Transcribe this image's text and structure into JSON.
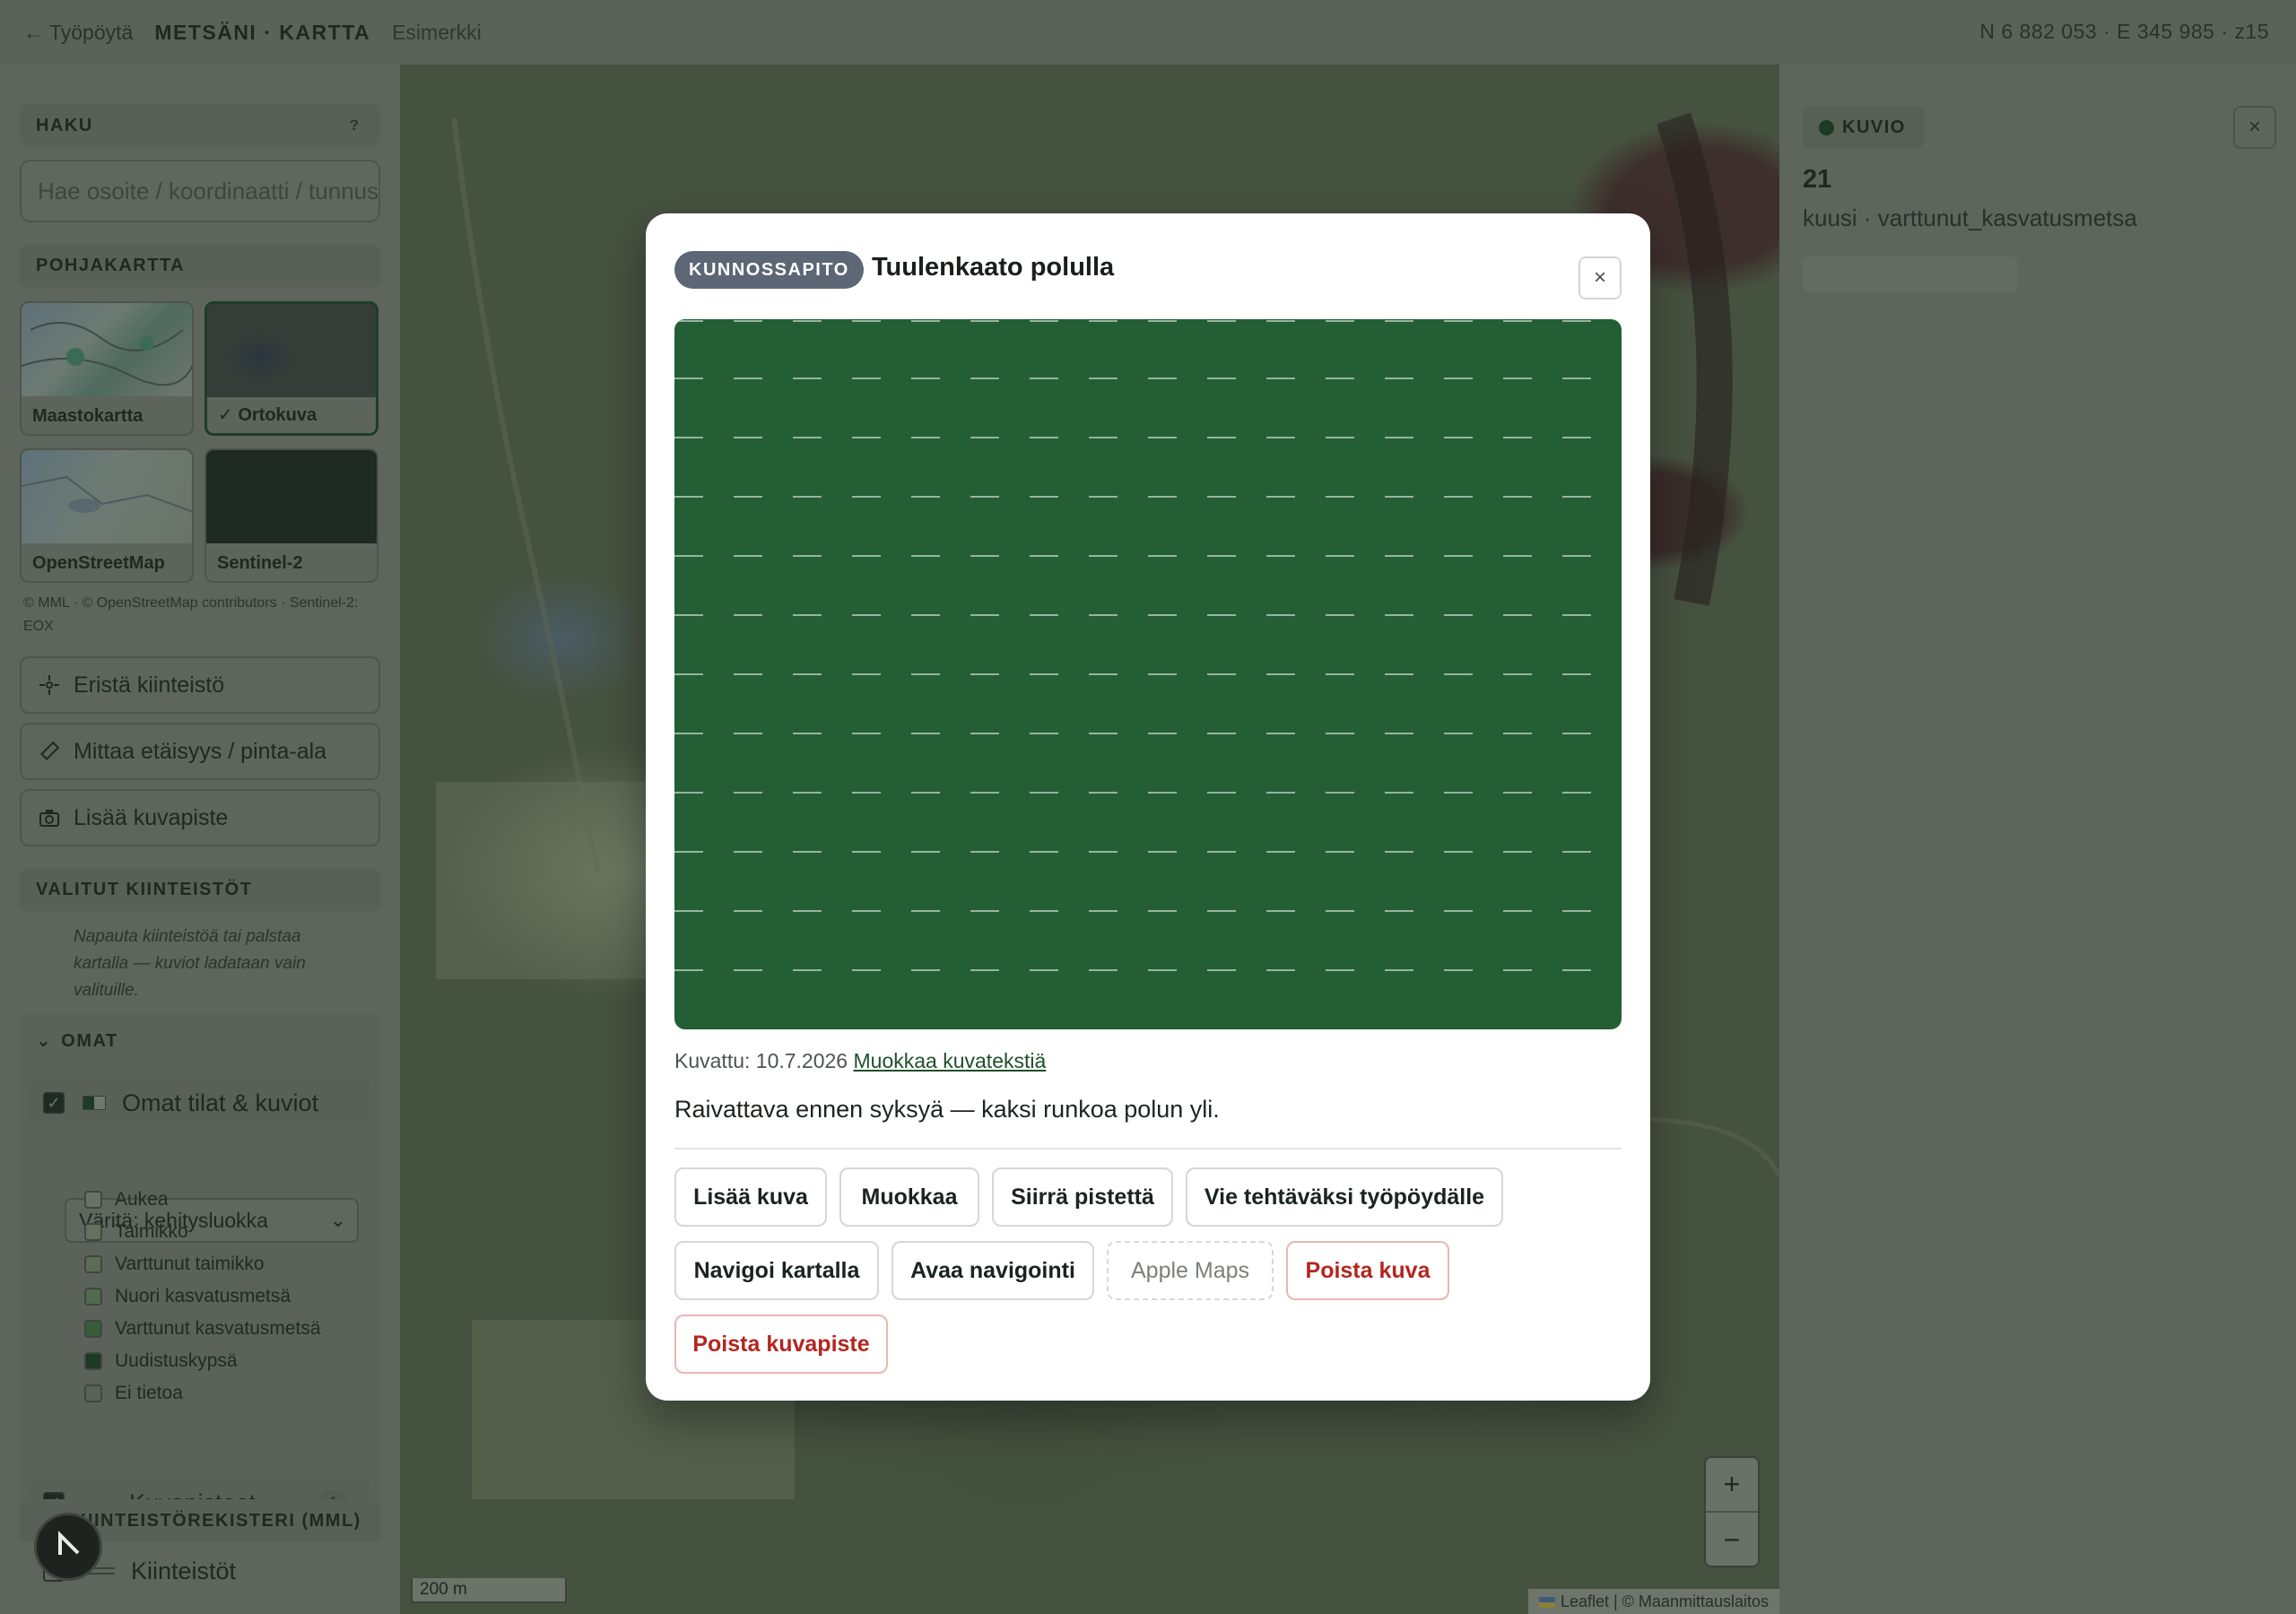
{
  "topbar": {
    "back": "← Työpöytä",
    "brand": "METSÄNI · KARTTA",
    "example": "Esimerkki",
    "coords": "N 6 882 053 · E 345 985 · z15"
  },
  "sidebar": {
    "search_head": "HAKU",
    "search_help": "?",
    "search_placeholder": "Hae osoite / koordinaatti / tunnus",
    "basemap_head": "POHJAKARTTA",
    "basemaps": [
      {
        "label": "Maastokartta",
        "selected": false
      },
      {
        "label": "✓ Ortokuva",
        "selected": true
      },
      {
        "label": "OpenStreetMap",
        "selected": false
      },
      {
        "label": "Sentinel-2",
        "selected": false
      }
    ],
    "credit": "© MML · © OpenStreetMap contributors · Sentinel-2: EOX",
    "tools": [
      {
        "label": "Eristä kiinteistö",
        "icon": "crosshair-icon"
      },
      {
        "label": "Mittaa etäisyys / pinta-ala",
        "icon": "ruler-icon"
      },
      {
        "label": "Lisää kuvapiste",
        "icon": "camera-icon"
      }
    ],
    "selected_head": "VALITUT KIINTEISTÖT",
    "selected_hint": "Napauta kiinteistöä tai palstaa kartalla — kuviot ladataan vain valituille.",
    "omat_head": "OMAT",
    "omat_layer": "Omat tilat & kuviot",
    "color_select": "Väritä: kehitysluokka",
    "legend": [
      {
        "label": "Aukea",
        "color": "#6a7266"
      },
      {
        "label": "Taimikko",
        "color": "#66705f"
      },
      {
        "label": "Varttunut taimikko",
        "color": "#5c6c57"
      },
      {
        "label": "Nuori kasvatusmetsä",
        "color": "#4f6a4c"
      },
      {
        "label": "Varttunut kasvatusmetsä",
        "color": "#385d3b"
      },
      {
        "label": "Uudistuskypsä",
        "color": "#1f3a24"
      },
      {
        "label": "Ei tietoa",
        "color": "#5a6159"
      }
    ],
    "photo_layer": "Kuvapisteet",
    "photo_count": "1",
    "registry_head": "KIINTEISTÖREKISTERI (MML)",
    "registry_layer": "Kiinteistöt"
  },
  "map": {
    "scale": "200 m",
    "attribution": "Leaflet | © Maanmittauslaitos",
    "zoom_in": "+",
    "zoom_out": "−"
  },
  "right_panel": {
    "badge": "KUVIO",
    "close": "×",
    "number": "21",
    "description": "kuusi · varttunut_kasvatusmetsa"
  },
  "modal": {
    "tag": "KUNNOSSAPITO",
    "title": "Tuulenkaato polulla",
    "close": "×",
    "caption_prefix": "Kuvattu: 10.7.2026",
    "caption_link": "Muokkaa kuvatekstiä",
    "note": "Raivattava ennen syksyä — kaksi runkoa polun yli.",
    "buttons": {
      "add_photo": "Lisää kuva",
      "edit": "Muokkaa",
      "move_point": "Siirrä pistettä",
      "export_task": "Vie tehtäväksi työpöydälle",
      "navigate_map": "Navigoi kartalla",
      "open_navigation": "Avaa navigointi",
      "apple_maps": "Apple Maps",
      "delete_photo": "Poista kuva",
      "delete_point": "Poista kuvapiste"
    },
    "photo_color": "#245e35"
  }
}
